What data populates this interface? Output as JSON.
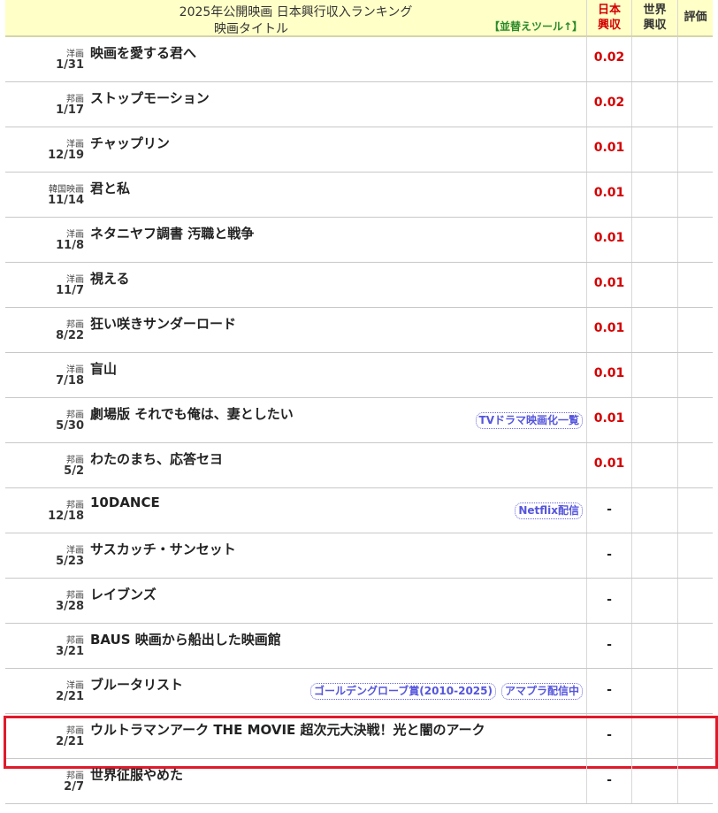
{
  "header": {
    "main_title": "2025年公開映画 日本興行収入ランキング",
    "sub_title": "映画タイトル",
    "sort_link": "【並替えツール↑】",
    "col_japan_line1": "日本",
    "col_japan_line2": "興収",
    "col_world_line1": "世界",
    "col_world_line2": "興収",
    "col_rating": "評価"
  },
  "rows": [
    {
      "genre": "洋画",
      "date": "1/31",
      "title": "映画を愛する君へ",
      "gross": "0.02",
      "tags": []
    },
    {
      "genre": "邦画",
      "date": "1/17",
      "title": "ストップモーション",
      "gross": "0.02",
      "tags": []
    },
    {
      "genre": "洋画",
      "date": "12/19",
      "title": "チャップリン",
      "gross": "0.01",
      "tags": []
    },
    {
      "genre": "韓国映画",
      "date": "11/14",
      "title": "君と私",
      "gross": "0.01",
      "tags": []
    },
    {
      "genre": "洋画",
      "date": "11/8",
      "title": "ネタニヤフ調書 汚職と戦争",
      "gross": "0.01",
      "tags": []
    },
    {
      "genre": "洋画",
      "date": "11/7",
      "title": "視える",
      "gross": "0.01",
      "tags": []
    },
    {
      "genre": "邦画",
      "date": "8/22",
      "title": "狂い咲きサンダーロード",
      "gross": "0.01",
      "tags": []
    },
    {
      "genre": "洋画",
      "date": "7/18",
      "title": "盲山",
      "gross": "0.01",
      "tags": []
    },
    {
      "genre": "邦画",
      "date": "5/30",
      "title": "劇場版 それでも俺は、妻としたい",
      "gross": "0.01",
      "tags": [
        "TVドラマ映画化一覧"
      ]
    },
    {
      "genre": "邦画",
      "date": "5/2",
      "title": "わたのまち、応答セヨ",
      "gross": "0.01",
      "tags": []
    },
    {
      "genre": "邦画",
      "date": "12/18",
      "title": "10DANCE",
      "gross": "-",
      "tags": [
        "Netflix配信"
      ]
    },
    {
      "genre": "洋画",
      "date": "5/23",
      "title": "サスカッチ・サンセット",
      "gross": "-",
      "tags": []
    },
    {
      "genre": "邦画",
      "date": "3/28",
      "title": "レイブンズ",
      "gross": "-",
      "tags": []
    },
    {
      "genre": "邦画",
      "date": "3/21",
      "title": "BAUS 映画から船出した映画館",
      "gross": "-",
      "tags": []
    },
    {
      "genre": "洋画",
      "date": "2/21",
      "title": "ブルータリスト",
      "gross": "-",
      "tags": [
        "ゴールデングローブ賞(2010-2025)",
        "アマプラ配信中"
      ]
    },
    {
      "genre": "邦画",
      "date": "2/21",
      "title": "ウルトラマンアーク THE MOVIE 超次元大決戦！光と闇のアーク",
      "gross": "-",
      "tags": [],
      "highlight": true
    },
    {
      "genre": "邦画",
      "date": "2/7",
      "title": "世界征服やめた",
      "gross": "-",
      "tags": []
    }
  ]
}
